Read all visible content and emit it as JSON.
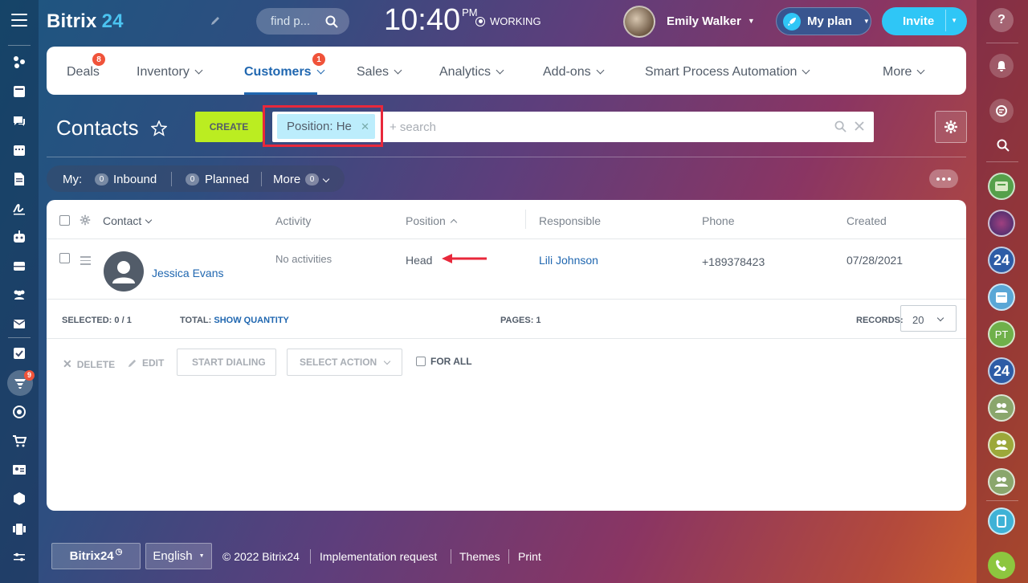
{
  "app": {
    "logo_name": "Bitrix",
    "logo_num": "24"
  },
  "header": {
    "search_placeholder": "find p...",
    "clock": "10:40",
    "clock_ampm": "PM",
    "status": "WORKING",
    "user_name": "Emily Walker",
    "plan_label": "My plan",
    "invite_label": "Invite"
  },
  "nav": {
    "items": [
      {
        "label": "Deals",
        "badge": "8"
      },
      {
        "label": "Inventory"
      },
      {
        "label": "Customers",
        "badge": "1",
        "active": true
      },
      {
        "label": "Sales"
      },
      {
        "label": "Analytics"
      },
      {
        "label": "Add-ons"
      },
      {
        "label": "Smart Process Automation"
      },
      {
        "label": "More"
      }
    ]
  },
  "page": {
    "title": "Contacts",
    "create_label": "CREATE",
    "filter_chip": "Position: He",
    "search_placeholder": "+ search"
  },
  "counters": {
    "my_label": "My:",
    "inbound_count": "0",
    "inbound_label": "Inbound",
    "planned_count": "0",
    "planned_label": "Planned",
    "more_label": "More",
    "more_count": "0"
  },
  "table": {
    "columns": [
      "Contact",
      "Activity",
      "Position",
      "Responsible",
      "Phone",
      "Created"
    ],
    "rows": [
      {
        "contact": "Jessica Evans",
        "activity": "No activities",
        "position": "Head",
        "responsible": "Lili Johnson",
        "phone": "+189378423",
        "created": "07/28/2021"
      }
    ]
  },
  "table_footer": {
    "selected_label": "SELECTED:",
    "selected_value": "0 / 1",
    "total_label": "TOTAL:",
    "total_link": "SHOW QUANTITY",
    "pages_label": "PAGES:",
    "pages_value": "1",
    "records_label": "RECORDS:",
    "records_value": "20"
  },
  "actions": {
    "delete": "DELETE",
    "edit": "EDIT",
    "start_dialing": "START DIALING",
    "select_action": "SELECT ACTION",
    "for_all": "FOR ALL"
  },
  "left_sidebar": {
    "badge": "9"
  },
  "right_sidebar": {
    "pt_initials": "PT",
    "b24_label": "24"
  },
  "footer": {
    "logo": "Bitrix24",
    "language": "English",
    "copyright": "© 2022 Bitrix24",
    "implementation": "Implementation request",
    "themes": "Themes",
    "print": "Print"
  },
  "colors": {
    "accent": "#2067b0",
    "create": "#bbed21",
    "invite": "#2fc6f6",
    "badge": "#f0533a",
    "highlight": "#e8283b"
  }
}
